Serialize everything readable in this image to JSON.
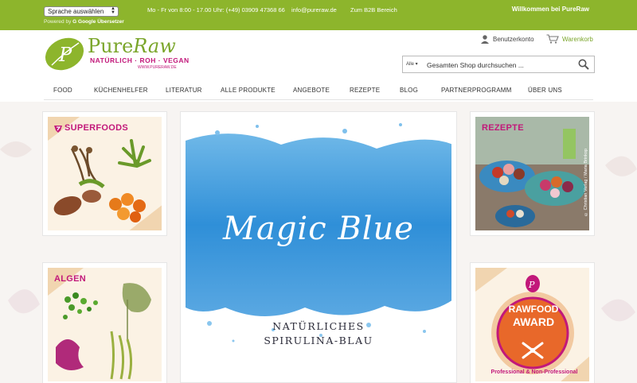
{
  "topbar": {
    "language_select": "Sprache auswählen",
    "powered_by": "Powered by",
    "translator": "Google Übersetzer",
    "hours": "Mo - Fr von 8:00 - 17.00 Uhr: (+49) 03909 47368 66",
    "email": "info@pureraw.de",
    "b2b": "Zum B2B Bereich",
    "welcome": "Willkommen bei PureRaw"
  },
  "logo": {
    "brand_a": "Pure",
    "brand_b": "Raw",
    "tagline": "NATÜRLICH · ROH · VEGAN",
    "url": "WWW.PURERAW.DE"
  },
  "header": {
    "account": "Benutzerkonto",
    "cart": "Warenkorb",
    "search_scope": "Alle",
    "search_placeholder": "Gesamten Shop durchsuchen ..."
  },
  "nav": {
    "items": [
      "FOOD",
      "KÜCHENHELFER",
      "LITERATUR",
      "ALLE PRODUKTE",
      "ANGEBOTE",
      "REZEPTE",
      "BLOG",
      "PARTNERPROGRAMM",
      "ÜBER UNS"
    ]
  },
  "tiles": {
    "superfoods": "SUPERFOODS",
    "algen": "ALGEN",
    "rezepte": "REZEPTE",
    "rezepte_credit": "© Christian Verlag / Maria Brinkop",
    "award_line1": "RAWFOOD",
    "award_line2": "AWARD",
    "award_curve": "Professional & Non-Professional"
  },
  "hero": {
    "title": "Magic Blue",
    "sub1": "NATÜRLICHES",
    "sub2": "SPIRULINA-BLAU"
  },
  "colors": {
    "brand_green": "#8db52c",
    "accent_magenta": "#c2187a",
    "hero_blue": "#2f8fd8"
  }
}
